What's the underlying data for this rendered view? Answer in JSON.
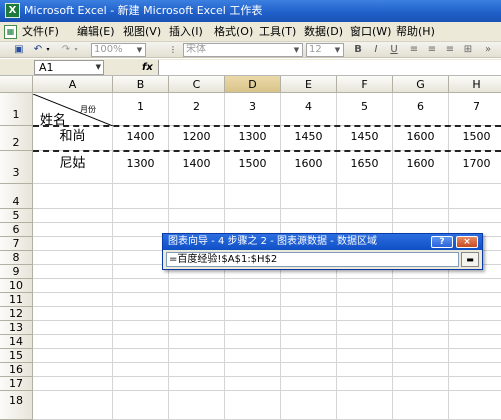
{
  "window": {
    "title": "Microsoft Excel - 新建 Microsoft Excel 工作表",
    "app_icon": "excel-icon"
  },
  "menu": {
    "doc_icon": "workbook-icon",
    "items": [
      {
        "label": "文件(F)"
      },
      {
        "label": "编辑(E)"
      },
      {
        "label": "视图(V)"
      },
      {
        "label": "插入(I)"
      },
      {
        "label": "格式(O)"
      },
      {
        "label": "工具(T)"
      },
      {
        "label": "数据(D)"
      },
      {
        "label": "窗口(W)"
      },
      {
        "label": "帮助(H)"
      }
    ]
  },
  "toolbar": {
    "save_icon": "save-icon",
    "undo_icon": "undo-icon",
    "redo_icon": "redo-icon",
    "zoom_value": "100%",
    "font_name": "宋体",
    "font_size": "12",
    "bold_label": "B",
    "italic_label": "I",
    "underline_label": "U",
    "align_icons": [
      "align-left-icon",
      "align-center-icon",
      "align-right-icon",
      "merge-center-icon"
    ]
  },
  "formula_bar": {
    "name_box": "A1",
    "fx_label": "fx",
    "content": ""
  },
  "sheet": {
    "columns": [
      "A",
      "B",
      "C",
      "D",
      "E",
      "F",
      "G",
      "H"
    ],
    "selected_column": "D",
    "rows": [
      "1",
      "2",
      "3",
      "4",
      "5",
      "6",
      "7",
      "8",
      "9",
      "10",
      "11",
      "12",
      "13",
      "14",
      "15",
      "16",
      "17",
      "18"
    ],
    "header_cell": {
      "top_right": "月份",
      "bottom_left": "姓名"
    },
    "row1_values": [
      "1",
      "2",
      "3",
      "4",
      "5",
      "6",
      "7"
    ],
    "data": [
      {
        "name": "和尚",
        "values": [
          "1400",
          "1200",
          "1300",
          "1450",
          "1450",
          "1600",
          "1500"
        ]
      },
      {
        "name": "尼姑",
        "values": [
          "1300",
          "1400",
          "1500",
          "1600",
          "1650",
          "1600",
          "1700"
        ]
      }
    ]
  },
  "dialog": {
    "title": "图表向导 - 4 步骤之 2 - 图表源数据 - 数据区域",
    "help_label": "?",
    "close_label": "×",
    "input_value": "=百度经验!$A$1:$H$2",
    "collapse_icon": "expand-dialog-icon"
  },
  "colors": {
    "title_bar": "#1f5fc8",
    "chrome": "#ece9d8",
    "selected_header": "#d8c38a"
  }
}
